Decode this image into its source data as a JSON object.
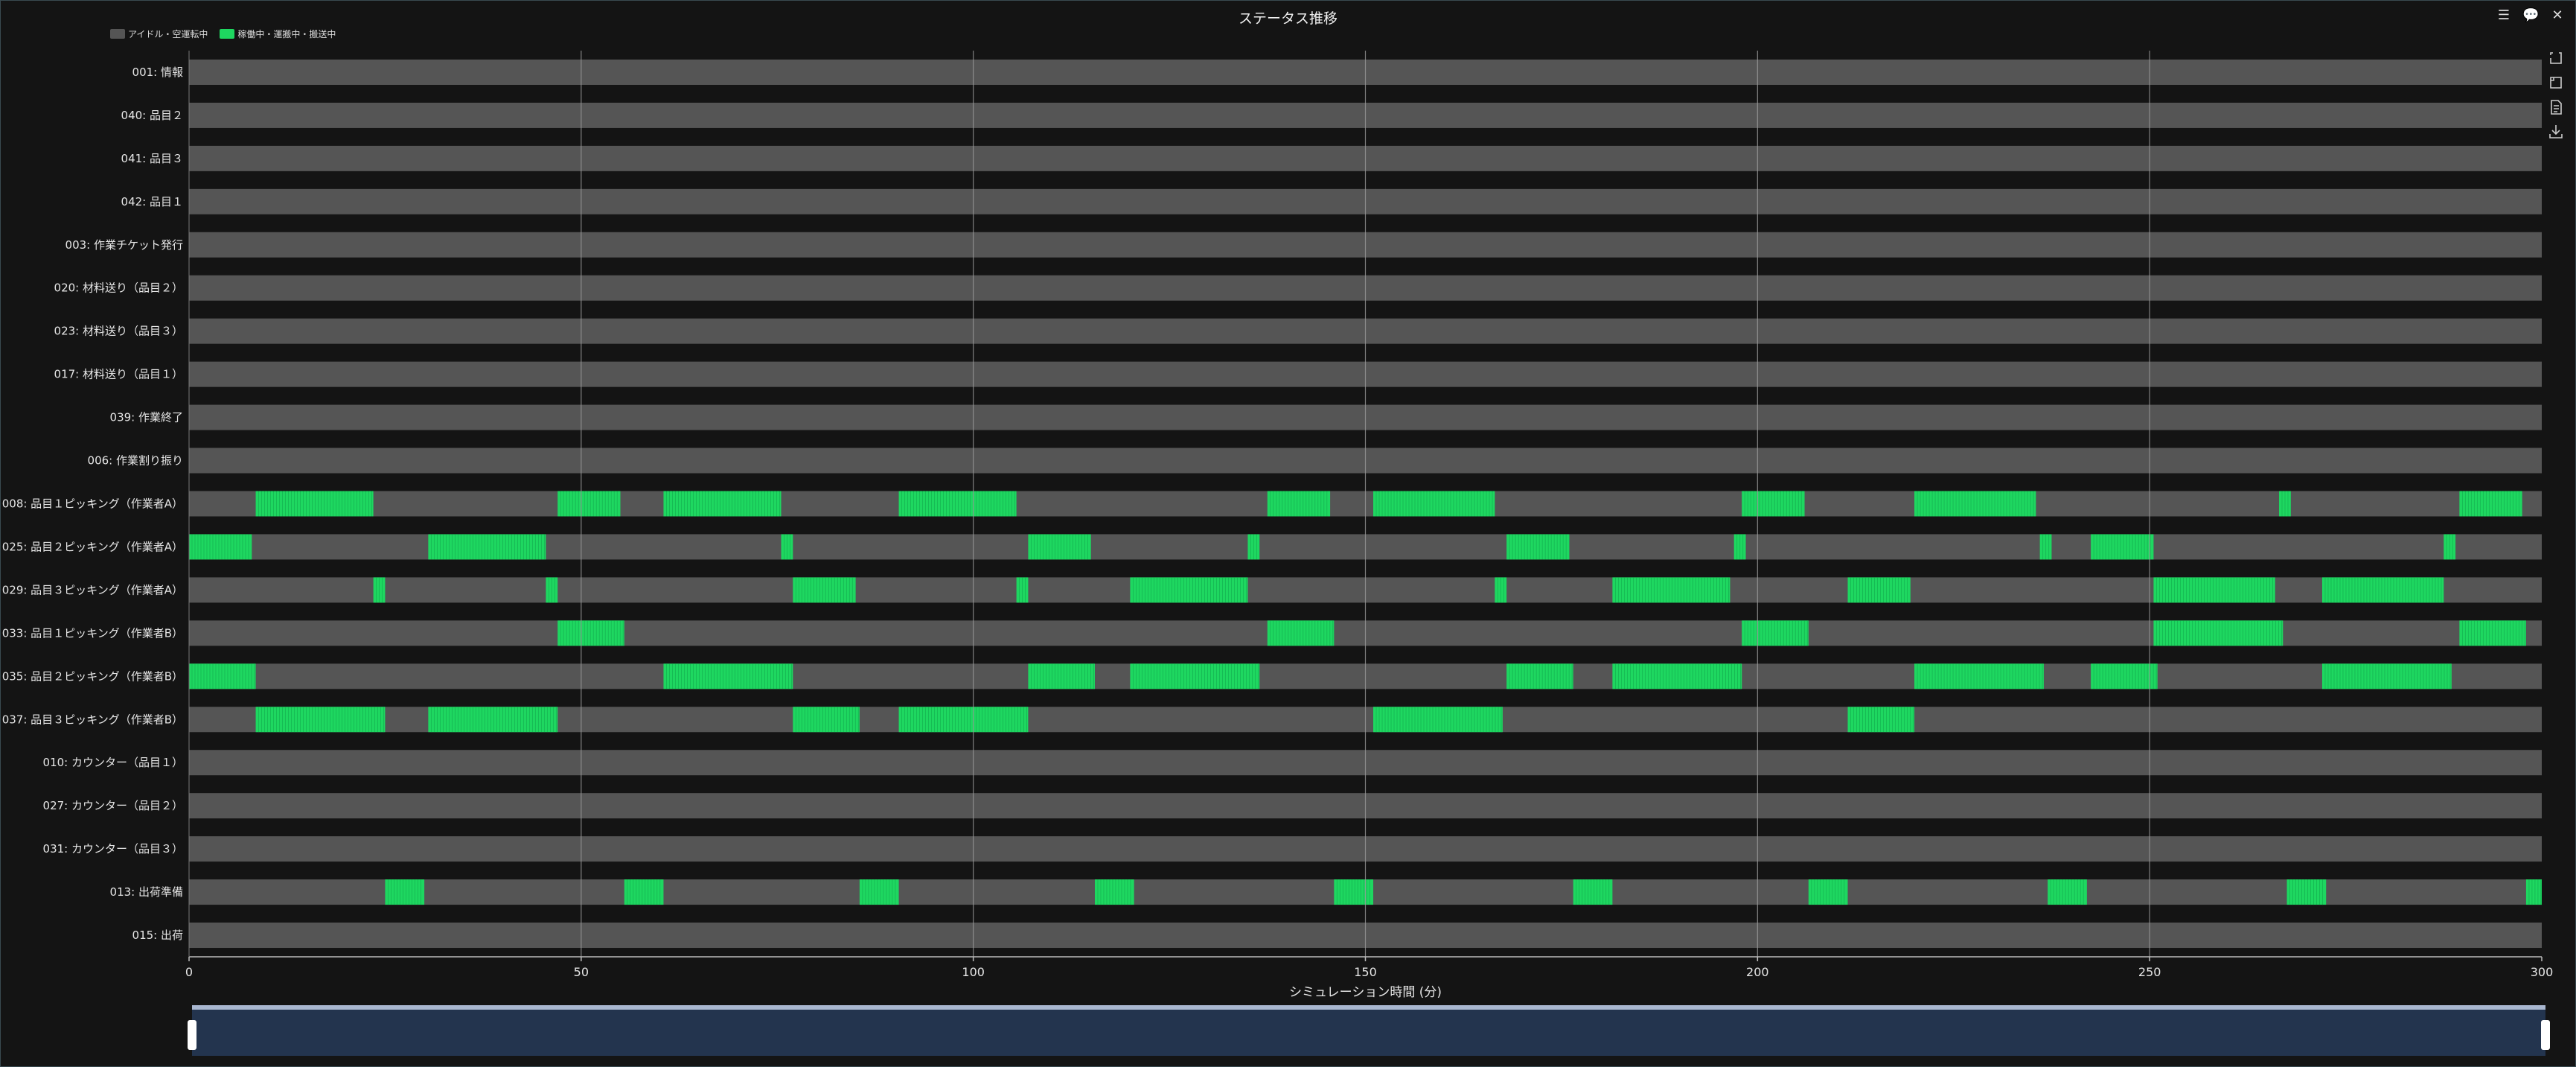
{
  "title": "ステータス推移",
  "legend": [
    {
      "label": "アイドル・空運転中",
      "color": "#555555"
    },
    {
      "label": "稼働中・運搬中・搬送中",
      "color": "#1ed760"
    }
  ],
  "toolbar_icons": [
    "list-icon",
    "comment-icon",
    "close-icon"
  ],
  "toolbar_glyphs": [
    "☰",
    "💬",
    "✕"
  ],
  "side_tools": [
    "zoom-select-icon",
    "zoom-reset-icon",
    "data-view-icon",
    "save-image-icon"
  ],
  "chart_data": {
    "type": "gantt",
    "xlabel": "シミュレーション時間 (分)",
    "xlim": [
      0,
      300
    ],
    "x_ticks": [
      "0",
      "50",
      "100",
      "150",
      "200",
      "250",
      "300"
    ],
    "grid": true,
    "legend_position": "top-left",
    "colors": {
      "idle": "#555555",
      "active": "#1ed760"
    },
    "rows": [
      {
        "label": "001: 情報",
        "active": []
      },
      {
        "label": "040: 品目２",
        "active": []
      },
      {
        "label": "041: 品目３",
        "active": []
      },
      {
        "label": "042: 品目１",
        "active": []
      },
      {
        "label": "003: 作業チケット発行",
        "active": []
      },
      {
        "label": "020: 材料送り（品目２）",
        "active": []
      },
      {
        "label": "023: 材料送り（品目３）",
        "active": []
      },
      {
        "label": "017: 材料送り（品目１）",
        "active": []
      },
      {
        "label": "039: 作業終了",
        "active": []
      },
      {
        "label": "006: 作業割り振り",
        "active": []
      },
      {
        "label": "008: 品目１ピッキング（作業者A）",
        "active": [
          [
            8.5,
            23.5
          ],
          [
            47,
            55
          ],
          [
            60.5,
            75.5
          ],
          [
            90.5,
            105.5
          ],
          [
            137.5,
            145.5
          ],
          [
            151,
            166.5
          ],
          [
            198,
            206
          ],
          [
            220,
            235.5
          ],
          [
            266.5,
            268
          ],
          [
            289.5,
            297.5
          ]
        ]
      },
      {
        "label": "025: 品目２ピッキング（作業者A）",
        "active": [
          [
            0,
            8
          ],
          [
            30.5,
            45.5
          ],
          [
            75.5,
            77
          ],
          [
            107,
            115
          ],
          [
            135,
            136.5
          ],
          [
            168,
            176
          ],
          [
            197,
            198.5
          ],
          [
            236,
            237.5
          ],
          [
            242.5,
            250.5
          ],
          [
            287.5,
            289
          ]
        ]
      },
      {
        "label": "029: 品目３ピッキング（作業者A）",
        "active": [
          [
            23.5,
            25
          ],
          [
            45.5,
            47
          ],
          [
            77,
            85
          ],
          [
            105.5,
            107
          ],
          [
            120,
            135
          ],
          [
            166.5,
            168
          ],
          [
            181.5,
            196.5
          ],
          [
            211.5,
            219.5
          ],
          [
            250.5,
            266
          ],
          [
            272,
            287.5
          ]
        ]
      },
      {
        "label": "033: 品目１ピッキング（作業者B）",
        "active": [
          [
            47,
            55.5
          ],
          [
            137.5,
            146
          ],
          [
            198,
            206.5
          ],
          [
            250.5,
            267
          ],
          [
            289.5,
            298
          ]
        ]
      },
      {
        "label": "035: 品目２ピッキング（作業者B）",
        "active": [
          [
            0,
            8.5
          ],
          [
            60.5,
            77
          ],
          [
            107,
            115.5
          ],
          [
            120,
            136.5
          ],
          [
            168,
            176.5
          ],
          [
            181.5,
            198
          ],
          [
            220,
            236.5
          ],
          [
            242.5,
            251
          ],
          [
            272,
            288.5
          ]
        ]
      },
      {
        "label": "037: 品目３ピッキング（作業者B）",
        "active": [
          [
            8.5,
            25
          ],
          [
            30.5,
            47
          ],
          [
            77,
            85.5
          ],
          [
            90.5,
            107
          ],
          [
            151,
            167.5
          ],
          [
            211.5,
            220
          ]
        ]
      },
      {
        "label": "010: カウンター（品目１）",
        "active": []
      },
      {
        "label": "027: カウンター（品目２）",
        "active": []
      },
      {
        "label": "031: カウンター（品目３）",
        "active": []
      },
      {
        "label": "013: 出荷準備",
        "active": [
          [
            25,
            30
          ],
          [
            55.5,
            60.5
          ],
          [
            85.5,
            90.5
          ],
          [
            115.5,
            120.5
          ],
          [
            146,
            151
          ],
          [
            176.5,
            181.5
          ],
          [
            206.5,
            211.5
          ],
          [
            237,
            242
          ],
          [
            267.5,
            272.5
          ],
          [
            298,
            300
          ]
        ]
      },
      {
        "label": "015: 出荷",
        "active": []
      }
    ]
  }
}
